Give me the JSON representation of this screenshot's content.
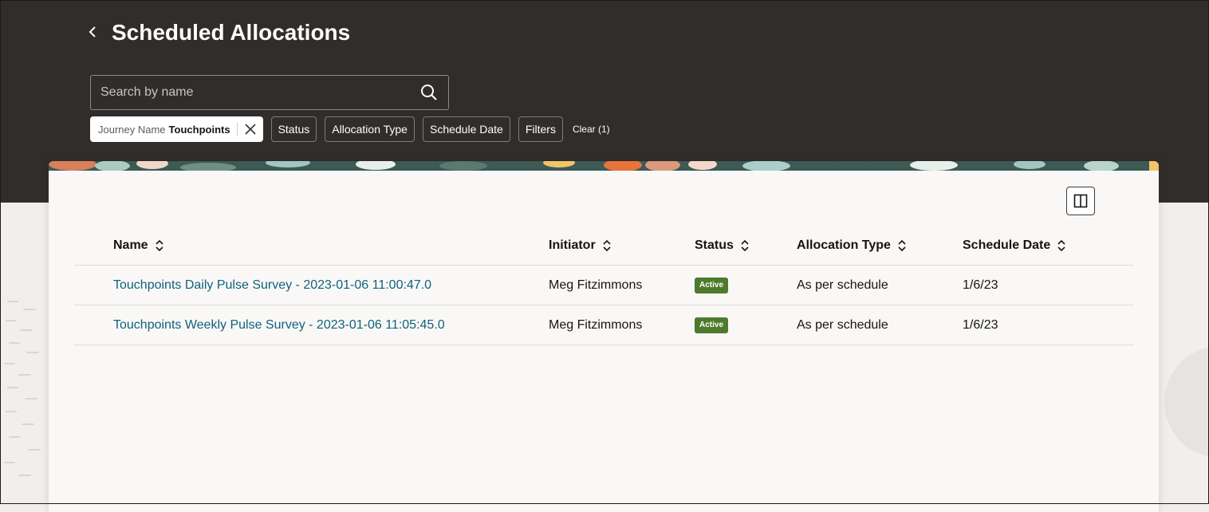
{
  "page": {
    "title": "Scheduled Allocations"
  },
  "search": {
    "placeholder": "Search by name",
    "value": ""
  },
  "filters": {
    "active_chip": {
      "key": "Journey Name",
      "value": "Touchpoints"
    },
    "chips": [
      "Status",
      "Allocation Type",
      "Schedule Date",
      "Filters"
    ],
    "clear_label": "Clear (1)"
  },
  "table": {
    "columns": [
      "Name",
      "Initiator",
      "Status",
      "Allocation Type",
      "Schedule Date"
    ],
    "rows": [
      {
        "name": "Touchpoints Daily Pulse Survey - 2023-01-06 11:00:47.0",
        "initiator": "Meg Fitzimmons",
        "status": "Active",
        "allocation_type": "As per schedule",
        "schedule_date": "1/6/23"
      },
      {
        "name": "Touchpoints Weekly Pulse Survey - 2023-01-06 11:05:45.0",
        "initiator": "Meg Fitzimmons",
        "status": "Active",
        "allocation_type": "As per schedule",
        "schedule_date": "1/6/23"
      }
    ]
  },
  "colors": {
    "header_bg": "#312d2a",
    "link": "#11607f",
    "status_active": "#4e7a2c",
    "card_bg": "#f9f8f6"
  },
  "icons": {
    "back": "chevron-left-icon",
    "search": "search-icon",
    "chip_close": "close-icon",
    "sort": "sort-icon",
    "panel": "panel-toggle-icon"
  }
}
